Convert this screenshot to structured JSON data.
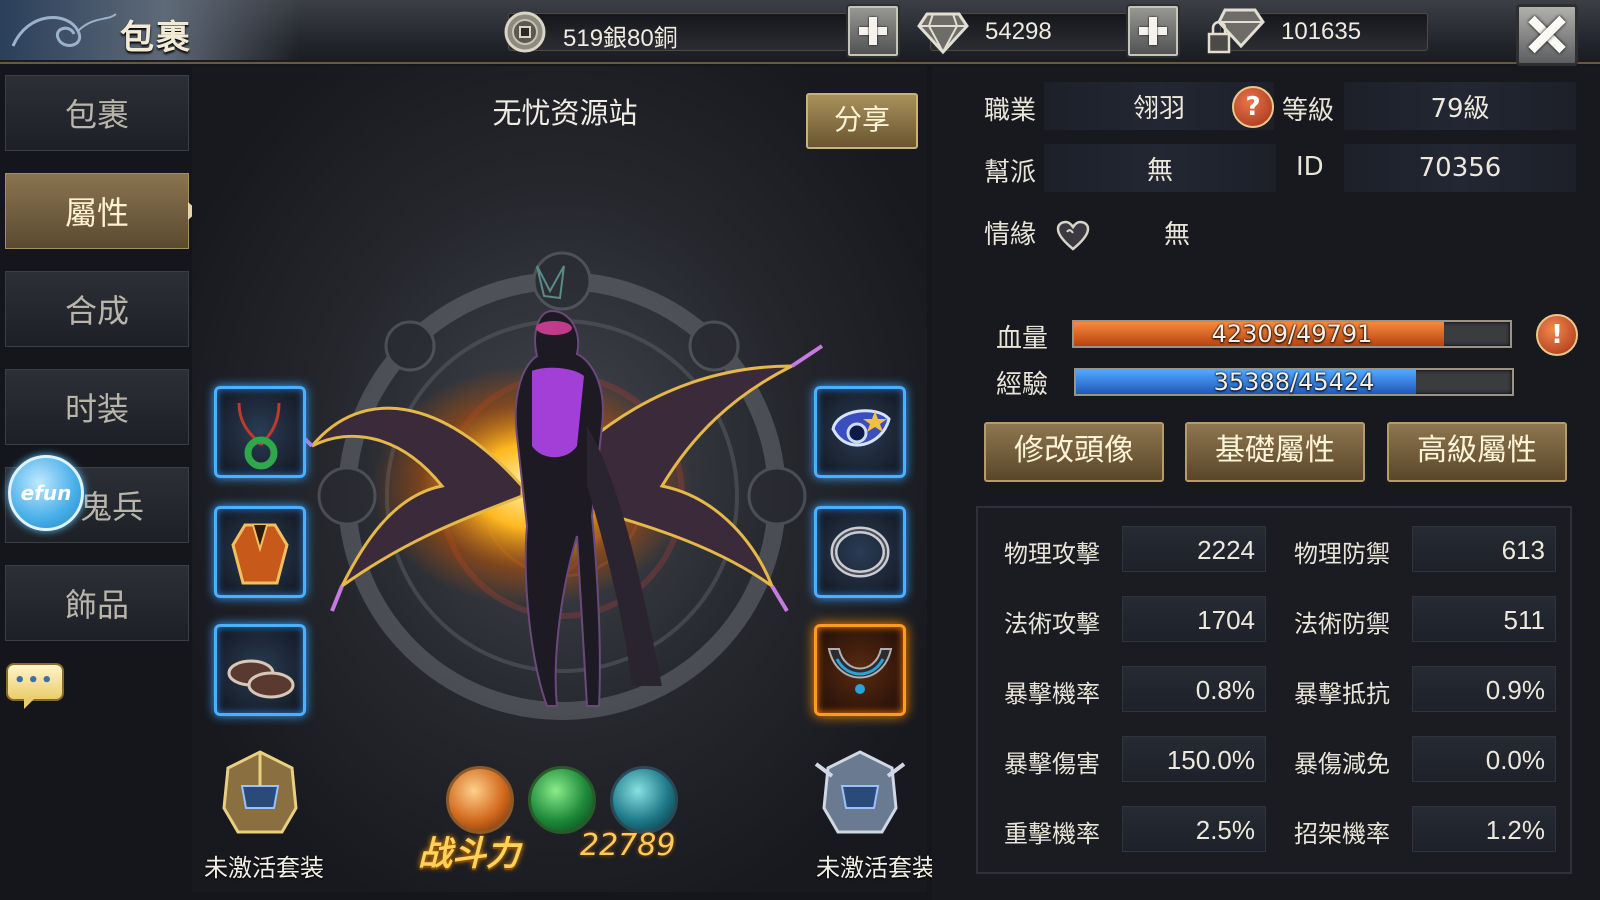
{
  "header": {
    "title": "包裹",
    "silver": "519銀80銅",
    "diamonds": "54298",
    "bound_diamonds": "101635"
  },
  "nav": {
    "items": [
      {
        "label": "包裹"
      },
      {
        "label": "屬性"
      },
      {
        "label": "合成"
      },
      {
        "label": "时装"
      },
      {
        "label": "鬼兵"
      },
      {
        "label": "飾品"
      }
    ],
    "active_index": 1
  },
  "overlay": {
    "efun_label": "efun",
    "chat_label": "•••"
  },
  "character": {
    "name": "无忧资源站",
    "share_label": "分享",
    "left_set_label": "未激活套装",
    "right_set_label": "未激活套装",
    "power_label": "战斗力",
    "power_value": "22789",
    "equipment": [
      "necklace-icon",
      "armor-icon",
      "boots-icon",
      "ornament-icon",
      "ring-icon",
      "collar-icon"
    ]
  },
  "profile": {
    "class_label": "職業",
    "class_value": "翎羽",
    "level_label": "等級",
    "level_value": "79級",
    "guild_label": "幫派",
    "guild_value": "無",
    "id_label": "ID",
    "id_value": "70356",
    "partner_label": "情緣",
    "partner_value": "無"
  },
  "bars": {
    "hp_label": "血量",
    "hp_text": "42309/49791",
    "hp_current": 42309,
    "hp_max": 49791,
    "xp_label": "經驗",
    "xp_text": "35388/45424",
    "xp_current": 35388,
    "xp_max": 45424
  },
  "buttons": {
    "avatar": "修改頭像",
    "basic": "基礎屬性",
    "advanced": "高級屬性"
  },
  "stats": [
    {
      "label": "物理攻擊",
      "value": "2224"
    },
    {
      "label": "物理防禦",
      "value": "613"
    },
    {
      "label": "法術攻擊",
      "value": "1704"
    },
    {
      "label": "法術防禦",
      "value": "511"
    },
    {
      "label": "暴擊機率",
      "value": "0.8%"
    },
    {
      "label": "暴擊抵抗",
      "value": "0.9%"
    },
    {
      "label": "暴擊傷害",
      "value": "150.0%"
    },
    {
      "label": "暴傷減免",
      "value": "0.0%"
    },
    {
      "label": "重擊機率",
      "value": "2.5%"
    },
    {
      "label": "招架機率",
      "value": "1.2%"
    }
  ],
  "colors": {
    "accent_gold": "#8a7450",
    "hp_bar": "#e06a2a",
    "xp_bar": "#3a88e8",
    "slot_glow": "#4ab0ff",
    "rare_glow": "#ff9a20"
  }
}
